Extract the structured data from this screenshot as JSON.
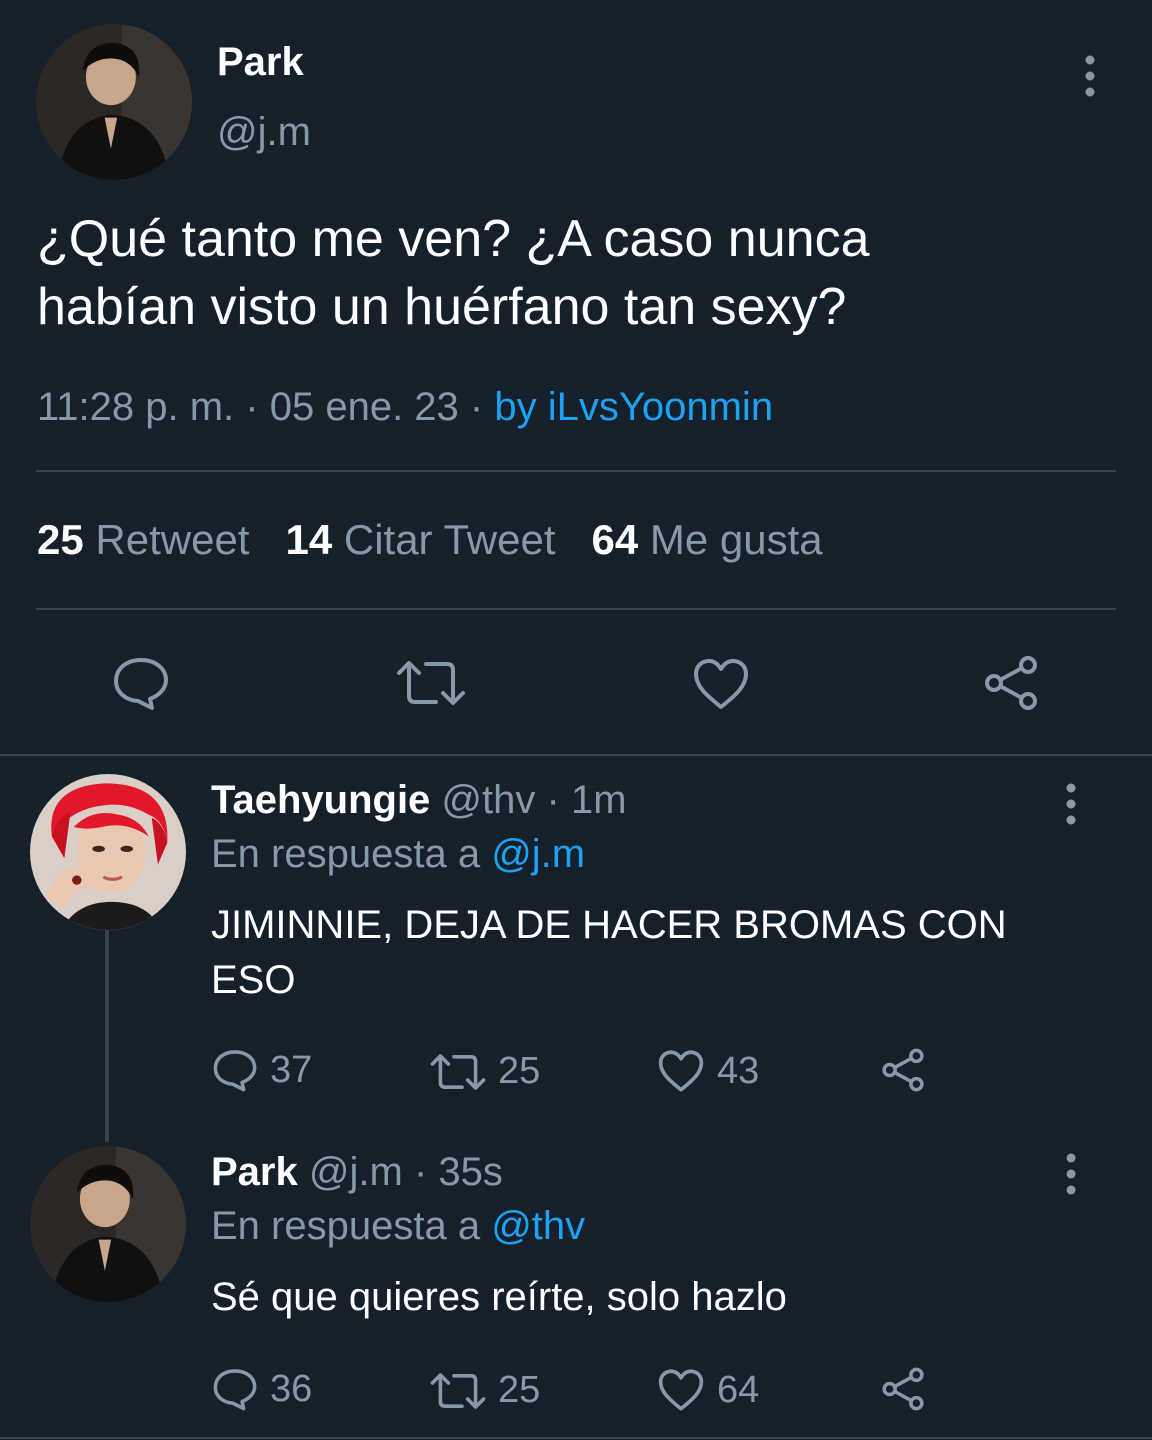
{
  "main_tweet": {
    "display_name": "Park",
    "handle": "@j.m",
    "text_line1": "¿Qué tanto me ven? ¿A caso nunca",
    "text_line2": "habían visto un huérfano tan sexy?",
    "time": "11:28 p. m.",
    "date": "05 ene. 23",
    "byline": "by iLvsYoonmin",
    "separator": "·",
    "stats": {
      "retweets_count": "25",
      "retweets_label": "Retweet",
      "quotes_count": "14",
      "quotes_label": "Citar Tweet",
      "likes_count": "64",
      "likes_label": "Me gusta"
    },
    "icons": [
      "reply-icon",
      "retweet-icon",
      "like-icon",
      "share-icon",
      "more-vertical-icon"
    ]
  },
  "replies": [
    {
      "display_name": "Taehyungie",
      "handle": "@thv",
      "time": "1m",
      "reply_to_label": "En respuesta a",
      "reply_to_handle": "@j.m",
      "text_line1": "JIMINNIE, DEJA DE HACER BROMAS CON",
      "text_line2": "ESO",
      "reply_count": "37",
      "retweet_count": "25",
      "like_count": "43"
    },
    {
      "display_name": "Park",
      "handle": "@j.m",
      "time": "35s",
      "reply_to_label": "En respuesta a",
      "reply_to_handle": "@thv",
      "text_line1": "Sé que quieres reírte, solo hazlo",
      "reply_count": "36",
      "retweet_count": "25",
      "like_count": "64"
    }
  ],
  "colors": {
    "background": "#15202b",
    "text": "#ffffff",
    "muted": "#8899a6",
    "accent": "#1da1f2",
    "divider": "#38444d"
  }
}
